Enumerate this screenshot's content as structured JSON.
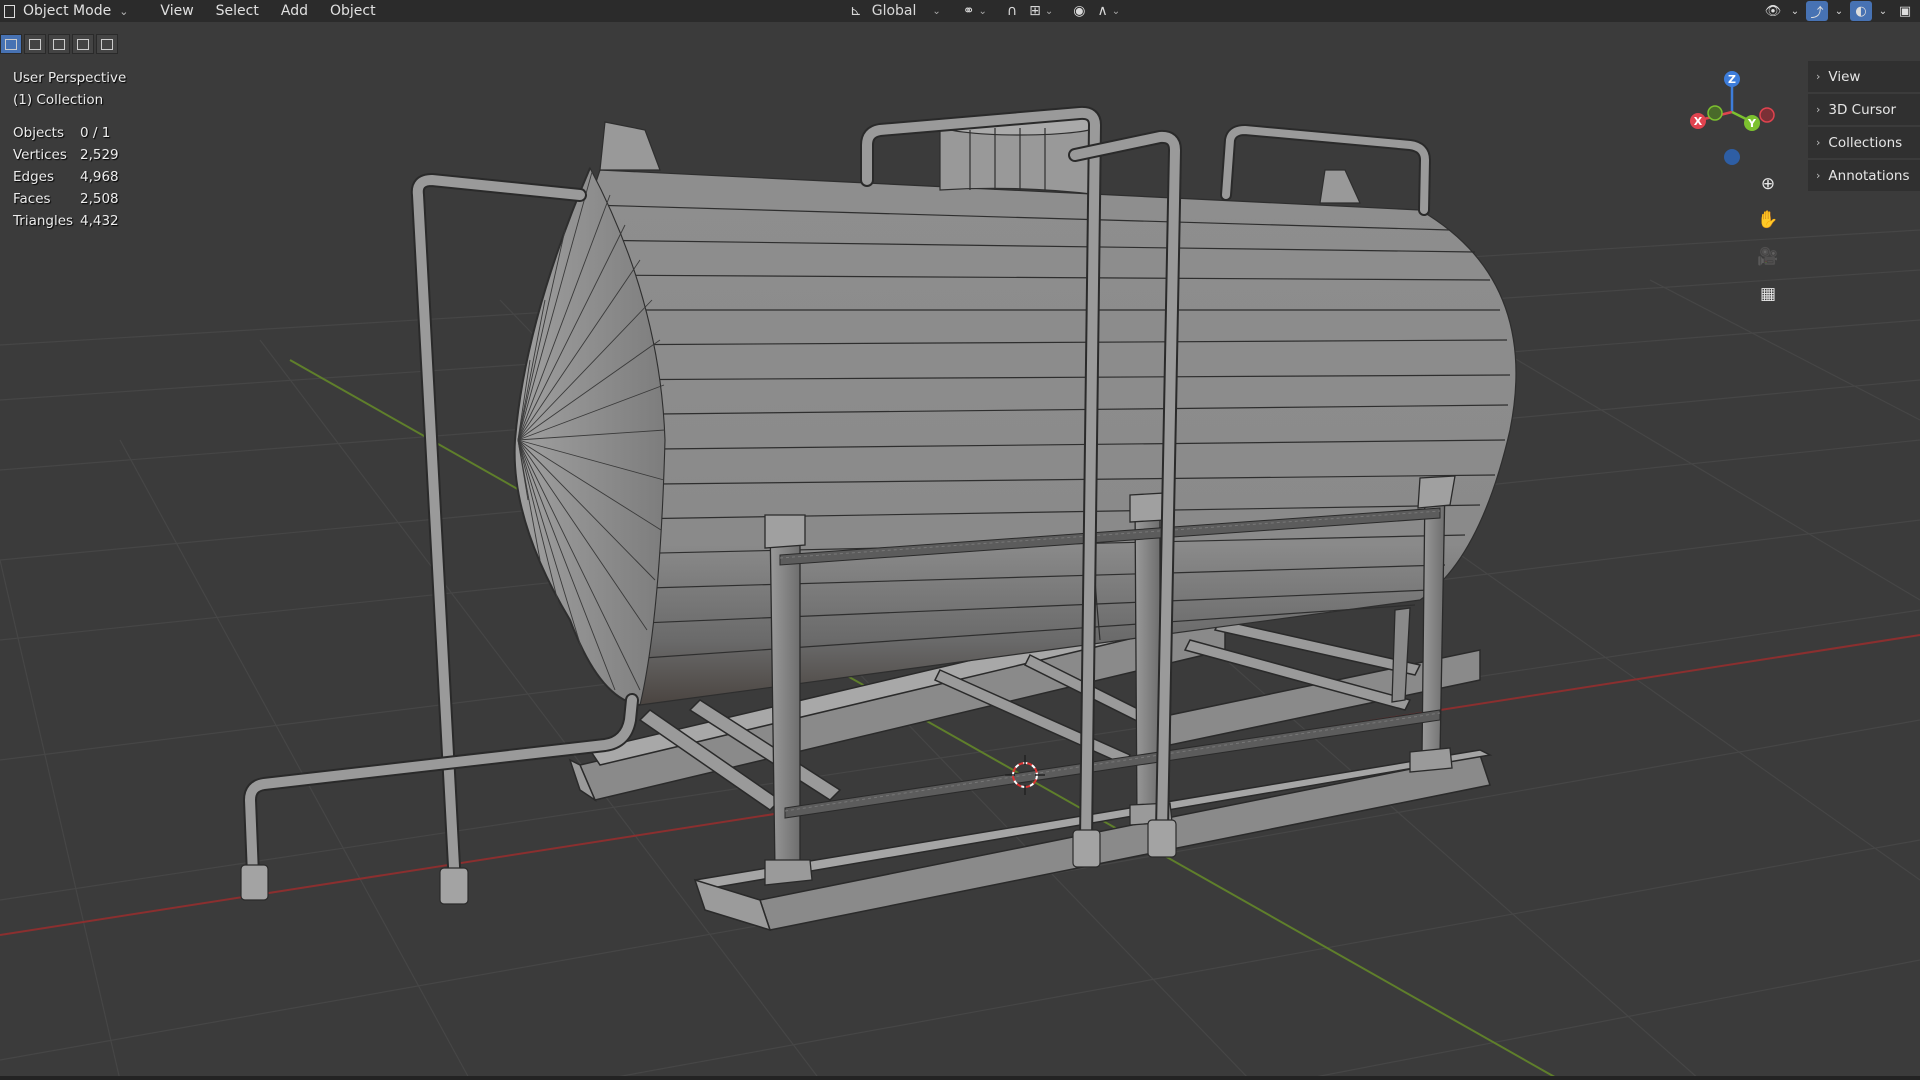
{
  "header": {
    "mode": "Object Mode",
    "menus": [
      "View",
      "Select",
      "Add",
      "Object"
    ],
    "transform_orientation": "Global"
  },
  "overlay": {
    "view_name": "User Perspective",
    "collection": "(1) Collection"
  },
  "stats": [
    {
      "label": "Objects",
      "value": "0 / 1"
    },
    {
      "label": "Vertices",
      "value": "2,529"
    },
    {
      "label": "Edges",
      "value": "4,968"
    },
    {
      "label": "Faces",
      "value": "2,508"
    },
    {
      "label": "Triangles",
      "value": "4,432"
    }
  ],
  "sidebar": {
    "items": [
      {
        "label": "View"
      },
      {
        "label": "3D Cursor"
      },
      {
        "label": "Collections"
      },
      {
        "label": "Annotations"
      }
    ]
  },
  "gizmo": {
    "axes": {
      "x": "X",
      "y": "Y",
      "z": "Z"
    },
    "colors": {
      "x": "#e0434f",
      "y": "#7cc12f",
      "z": "#3d7ddb",
      "z_neg": "#2e5ea4"
    }
  },
  "nav_icons": [
    "zoom-icon",
    "pan-hand-icon",
    "camera-icon",
    "perspective-grid-icon"
  ],
  "colors": {
    "viewport_bg": "#3b3b3b",
    "header_bg": "#2b2b2b",
    "grid_line": "#454545",
    "x_axis": "#8b2f2f",
    "y_axis": "#5f7f2b",
    "mesh_face": "#8f8f8f",
    "wire": "#2a2a2a",
    "active_blue": "#4772b3"
  }
}
